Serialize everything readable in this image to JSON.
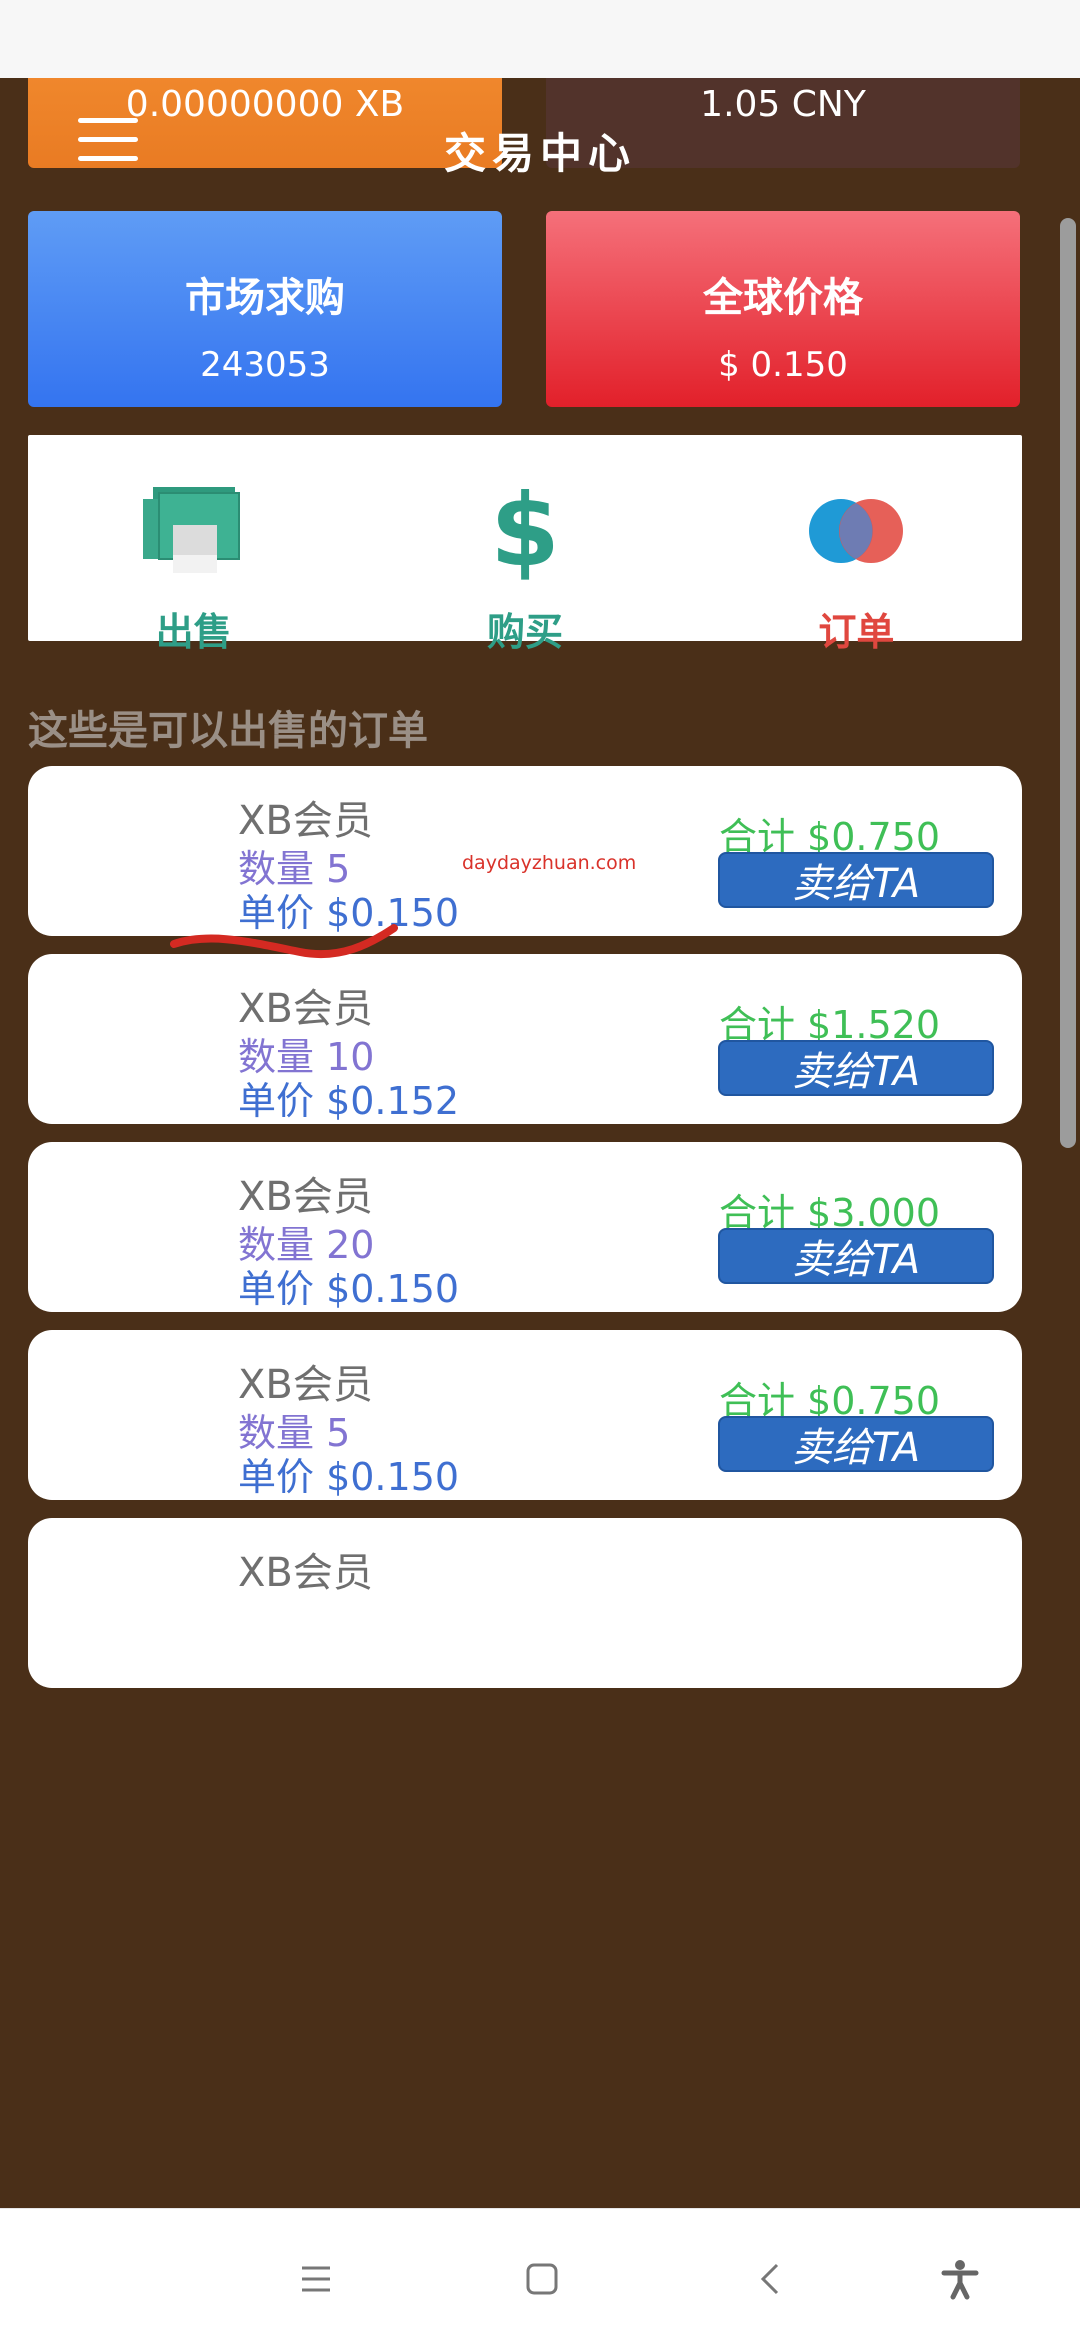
{
  "header": {
    "title": "交易中心",
    "balance_xb": "0.00000000 XB",
    "balance_cny": "1.05 CNY"
  },
  "stats": {
    "market_label": "市场求购",
    "market_value": "243053",
    "price_label": "全球价格",
    "price_value": "$ 0.150"
  },
  "actions": [
    {
      "label": "出售",
      "icon": "sell-money-icon",
      "color": "#2e9e87"
    },
    {
      "label": "购买",
      "icon": "dollar-icon",
      "color": "#2e9e87"
    },
    {
      "label": "订单",
      "icon": "orders-circles-icon",
      "color": "#e0473f"
    }
  ],
  "section_title": "这些是可以出售的订单",
  "watermark": "daydayzhuan.com",
  "orders": [
    {
      "product": "XB会员",
      "qty": "数量 5",
      "price": "单价 $0.150",
      "total": "合计 $0.750",
      "button": "卖给TA"
    },
    {
      "product": "XB会员",
      "qty": "数量 10",
      "price": "单价 $0.152",
      "total": "合计 $1.520",
      "button": "卖给TA"
    },
    {
      "product": "XB会员",
      "qty": "数量 20",
      "price": "单价 $0.150",
      "total": "合计 $3.000",
      "button": "卖给TA"
    },
    {
      "product": "XB会员",
      "qty": "数量 5",
      "price": "单价 $0.150",
      "total": "合计 $0.750",
      "button": "卖给TA"
    },
    {
      "product": "XB会员"
    }
  ],
  "colors": {
    "background": "#4a2f18",
    "accent_blue": "#2d6bbf",
    "total_green": "#3fbf56",
    "qty_purple": "#8274d2",
    "price_blue": "#3f6fd1"
  },
  "navbar": [
    "recent-apps-icon",
    "home-icon",
    "back-icon",
    "accessibility-icon"
  ]
}
